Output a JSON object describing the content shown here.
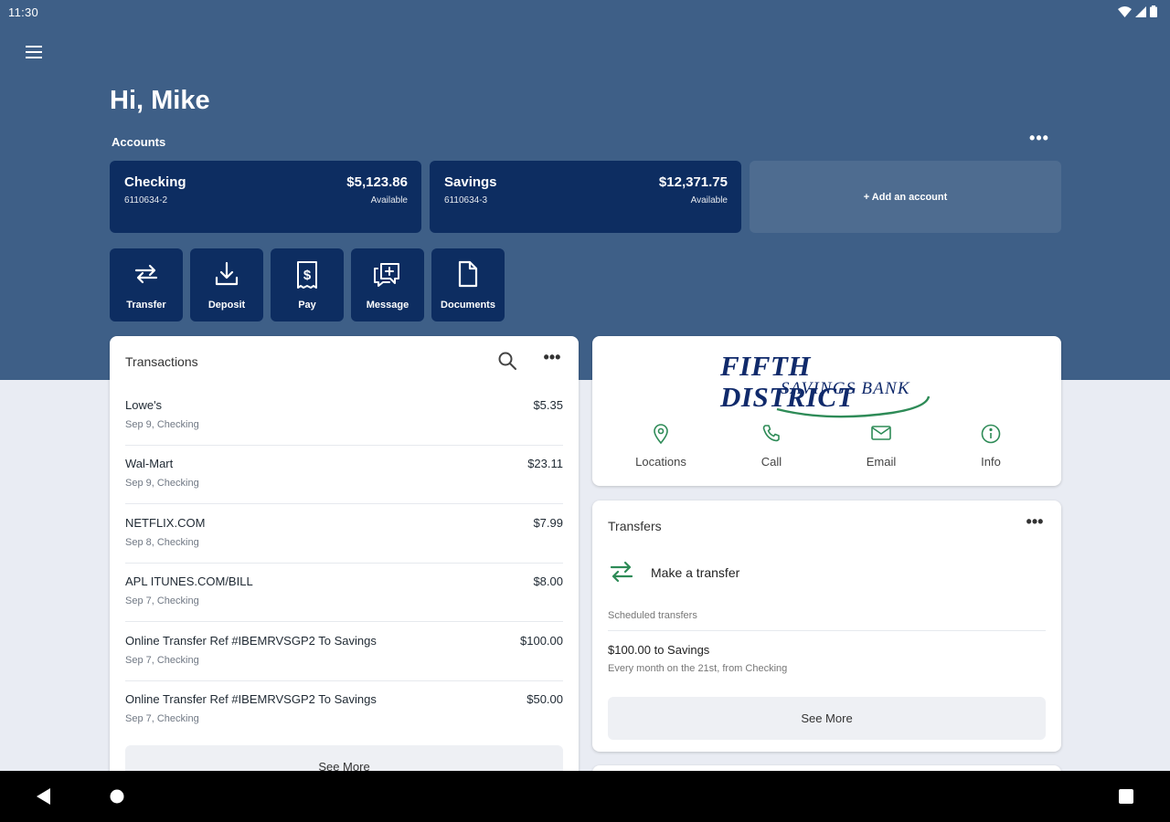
{
  "status_bar": {
    "time": "11:30",
    "icons": [
      "wifi-icon",
      "signal-icon",
      "battery-icon"
    ]
  },
  "header": {
    "menu_icon": "menu-icon",
    "greeting": "Hi, Mike"
  },
  "accounts": {
    "label": "Accounts",
    "more": "•••",
    "items": [
      {
        "name": "Checking",
        "number": "6110634-2",
        "balance": "$5,123.86",
        "balance_label": "Available"
      },
      {
        "name": "Savings",
        "number": "6110634-3",
        "balance": "$12,371.75",
        "balance_label": "Available"
      }
    ],
    "add_label": "+ Add an account"
  },
  "quick_actions": [
    {
      "label": "Transfer",
      "icon": "transfer-icon"
    },
    {
      "label": "Deposit",
      "icon": "deposit-icon"
    },
    {
      "label": "Pay",
      "icon": "pay-icon"
    },
    {
      "label": "Message",
      "icon": "message-icon"
    },
    {
      "label": "Documents",
      "icon": "document-icon"
    }
  ],
  "transactions": {
    "title": "Transactions",
    "more": "•••",
    "items": [
      {
        "merchant": "Lowe's",
        "sub": "Sep 9, Checking",
        "amount": "$5.35"
      },
      {
        "merchant": "Wal-Mart",
        "sub": "Sep 9, Checking",
        "amount": "$23.11"
      },
      {
        "merchant": "NETFLIX.COM",
        "sub": "Sep 8, Checking",
        "amount": "$7.99"
      },
      {
        "merchant": "APL ITUNES.COM/BILL",
        "sub": "Sep 7, Checking",
        "amount": "$8.00"
      },
      {
        "merchant": "Online Transfer Ref #IBEMRVSGP2 To Savings",
        "sub": "Sep 7, Checking",
        "amount": "$100.00"
      },
      {
        "merchant": "Online Transfer Ref #IBEMRVSGP2 To Savings",
        "sub": "Sep 7, Checking",
        "amount": "$50.00"
      }
    ],
    "see_more": "See More"
  },
  "bank": {
    "logo_line1": "FIFTH DISTRICT",
    "logo_line2": "SAVINGS BANK",
    "brand_color": "#102a6b",
    "accent_color": "#2e8b57",
    "actions": [
      {
        "label": "Locations",
        "icon": "location-pin-icon"
      },
      {
        "label": "Call",
        "icon": "phone-icon"
      },
      {
        "label": "Email",
        "icon": "email-icon"
      },
      {
        "label": "Info",
        "icon": "info-icon"
      }
    ]
  },
  "transfers": {
    "title": "Transfers",
    "more": "•••",
    "make_label": "Make a transfer",
    "scheduled_label": "Scheduled transfers",
    "scheduled": [
      {
        "title": "$100.00 to Savings",
        "detail": "Every month on the 21st, from Checking"
      }
    ],
    "see_more": "See More"
  },
  "colors": {
    "hero": "#3e5f87",
    "card_dark": "#0d2d61",
    "page_bg": "#e9ecf3"
  }
}
